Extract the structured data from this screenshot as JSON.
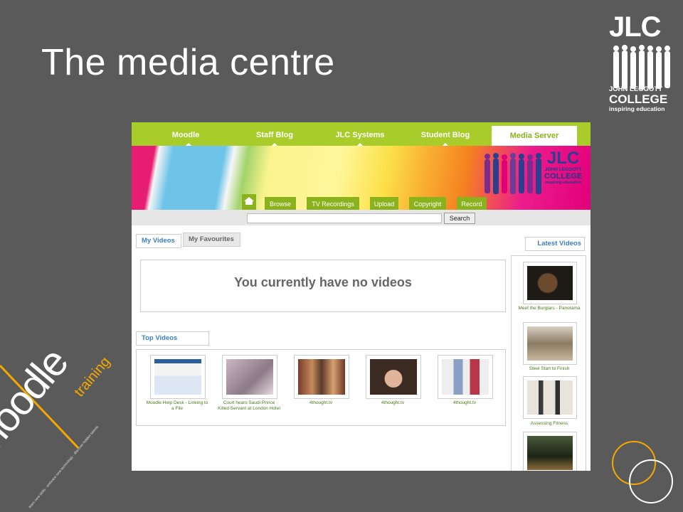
{
  "slide": {
    "title": "The media centre"
  },
  "jlc_logo": {
    "mark": "JLC",
    "line1": "JOHN LEGGOTT",
    "line2": "COLLEGE",
    "line3": "inspiring education"
  },
  "moodle_logo": {
    "word": "moodle",
    "sub": "training",
    "tagline": "learn new skills · embrace new technology · discover hidden talents"
  },
  "nav": {
    "items": [
      "Moodle",
      "Staff Blog",
      "JLC Systems",
      "Student Blog",
      "Media Server"
    ],
    "active_index": 4
  },
  "banner_logo": {
    "mark": "JLC",
    "line1": "JOHN LEGGOTT",
    "line2": "COLLEGE",
    "line3": "inspiring education"
  },
  "subtabs": [
    "Browse",
    "TV Recordings",
    "Upload",
    "Copyright",
    "Record"
  ],
  "search": {
    "value": "",
    "button": "Search"
  },
  "tabs": {
    "my_videos": "My Videos",
    "my_favourites": "My Favourites"
  },
  "empty_message": "You currently have no videos",
  "top_videos": {
    "heading": "Top Videos",
    "items": [
      {
        "caption": "Moodle Help Desk - Linking to a File"
      },
      {
        "caption": "Court hears Saudi Prince Killed Servant at London Hotel"
      },
      {
        "caption": "4thought.tv"
      },
      {
        "caption": "4thought.tv"
      },
      {
        "caption": "4thought.tv"
      }
    ]
  },
  "latest_videos": {
    "heading": "Latest Videos",
    "items": [
      {
        "caption": "Meet the Burglars - Panorama"
      },
      {
        "caption": "Steel Start to Finish"
      },
      {
        "caption": "Assessing Fitness"
      },
      {
        "caption": ""
      }
    ]
  },
  "colors": {
    "background": "#5a5a5a",
    "nav_green": "#a8cc2a",
    "accent_orange": "#f6a800",
    "link_blue": "#3b7fc4"
  }
}
